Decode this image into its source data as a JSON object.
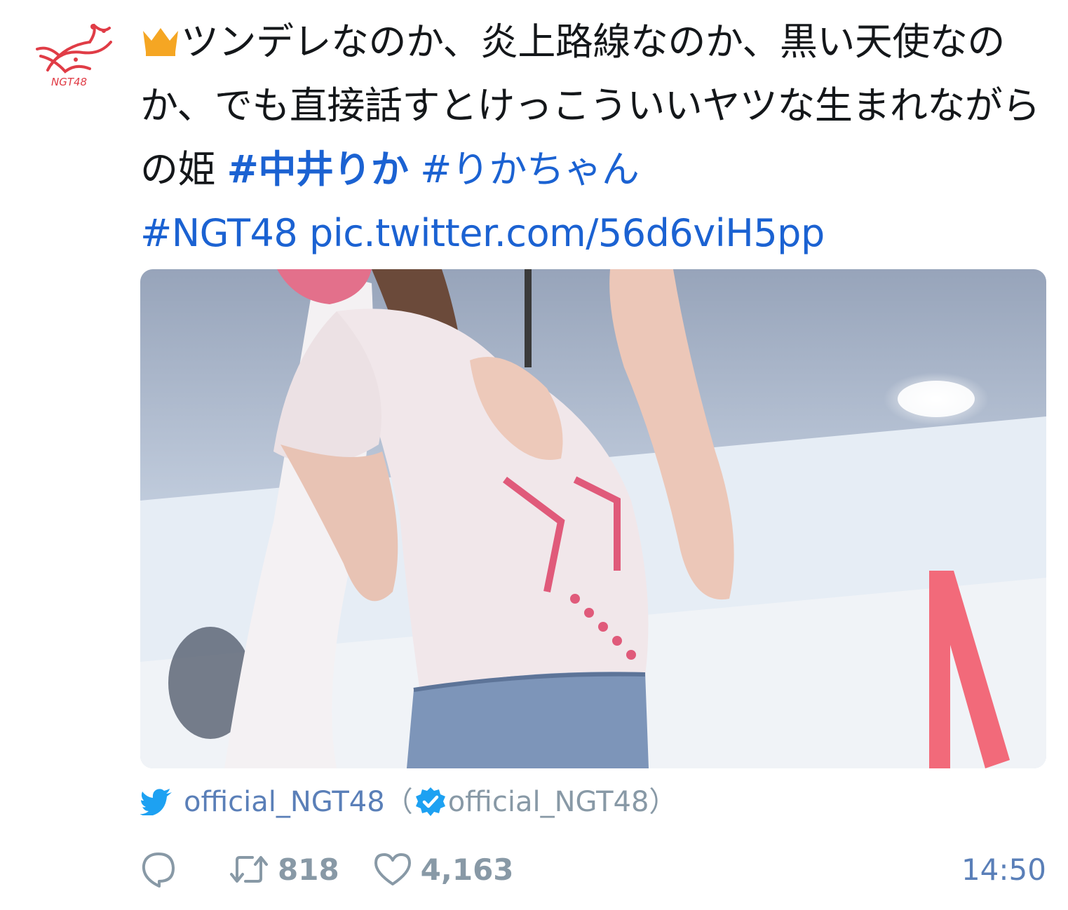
{
  "tweet": {
    "avatar_label": "NGT48",
    "text_parts": {
      "main": "ツンデレなのか、炎上路線なのか、黒い天使なのか、でも直接話すとけっこういいヤツな生まれながらの姫 ",
      "tag1": "#中井りか",
      "tag2": "#りかちゃん",
      "tag3": "#NGT48",
      "link": "pic.twitter.com/56d6viH5pp"
    }
  },
  "source": {
    "name": "official_NGT48",
    "open_paren": "（",
    "handle": "official_NGT48",
    "close_paren": "）"
  },
  "actions": {
    "retweets": "818",
    "likes": "4,163",
    "time": "14:50"
  },
  "icons": {
    "crown": "crown-icon",
    "bird": "twitter-bird-icon",
    "verified": "verified-badge-icon",
    "reply": "reply-icon",
    "retweet": "retweet-icon",
    "like": "heart-icon"
  },
  "colors": {
    "link": "#1b62d2",
    "muted": "#8899a6",
    "source": "#5a7fb8",
    "crown": "#f5a623"
  }
}
